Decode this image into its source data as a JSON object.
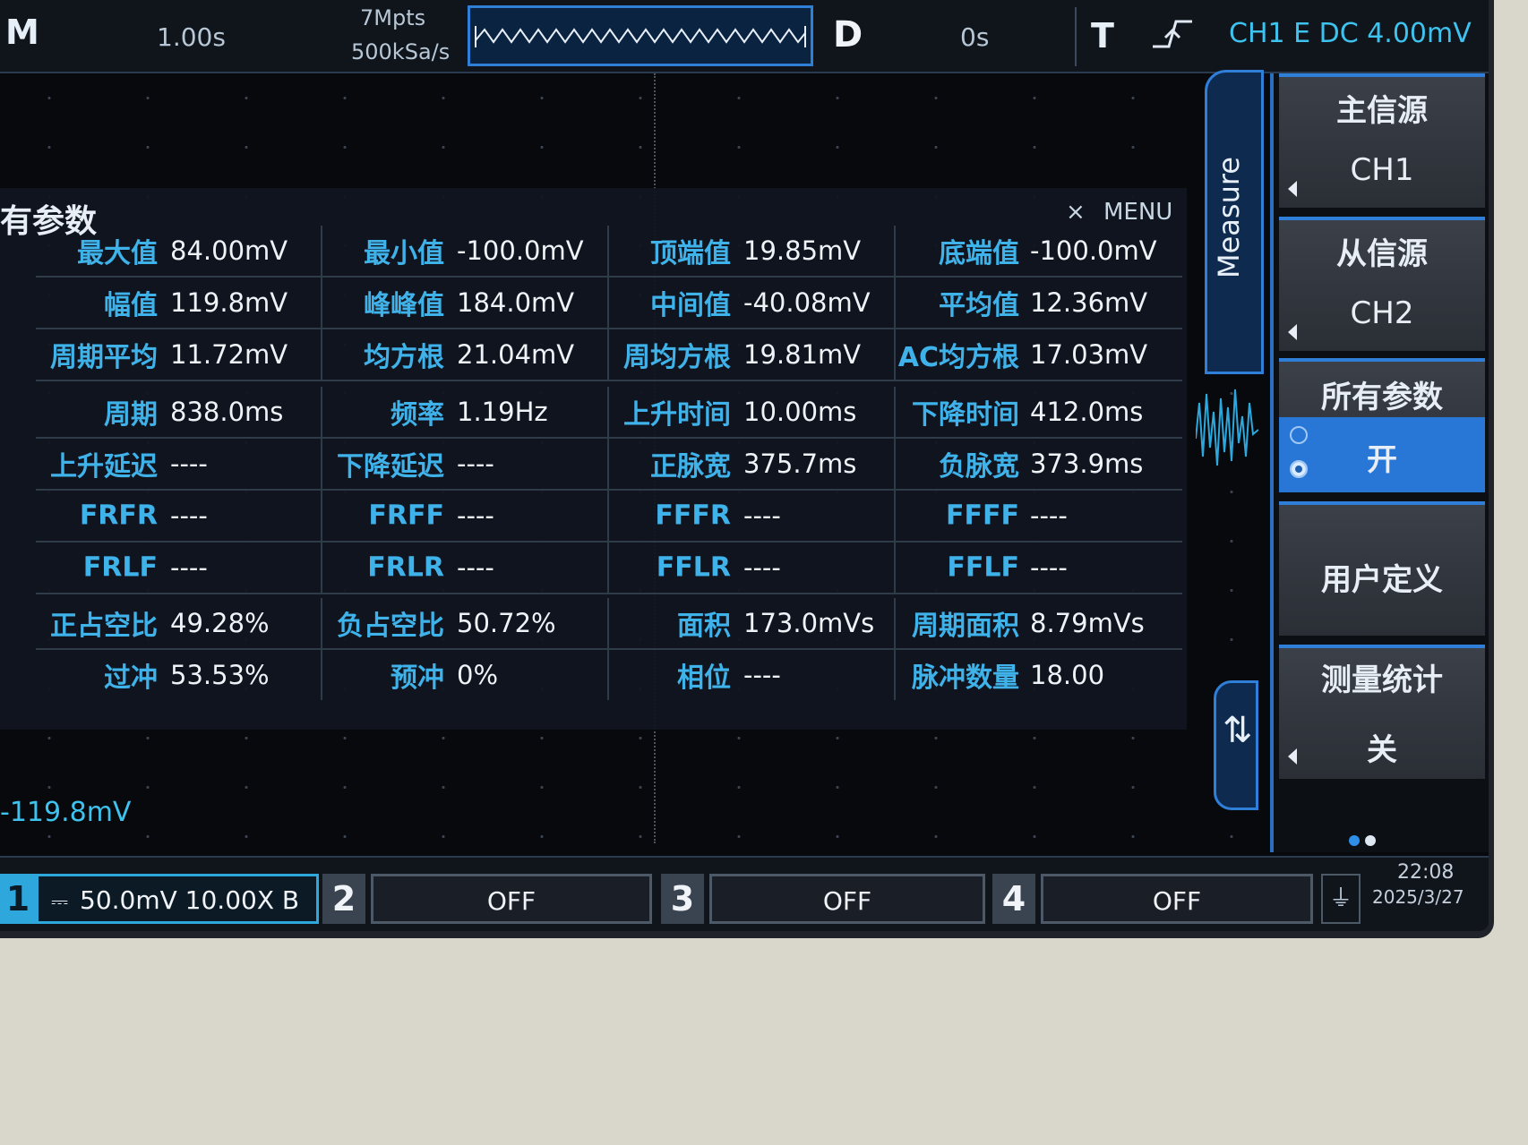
{
  "top_bar": {
    "mode": "M",
    "timebase": "1.00s",
    "memory_depth": "7Mpts",
    "sample_rate": "500kSa/s",
    "delay_label": "D",
    "delay_value": "0s",
    "trigger_label": "T",
    "trigger_info": "CH1 E DC 4.00mV"
  },
  "measure_panel": {
    "title": "有参数",
    "close_icon": "×",
    "menu_label": "MENU",
    "rows": [
      [
        [
          "最大值",
          "84.00mV"
        ],
        [
          "最小值",
          "-100.0mV"
        ],
        [
          "顶端值",
          "19.85mV"
        ],
        [
          "底端值",
          "-100.0mV"
        ]
      ],
      [
        [
          "幅值",
          "119.8mV"
        ],
        [
          "峰峰值",
          "184.0mV"
        ],
        [
          "中间值",
          "-40.08mV"
        ],
        [
          "平均值",
          "12.36mV"
        ]
      ],
      [
        [
          "周期平均",
          "11.72mV"
        ],
        [
          "均方根",
          "21.04mV"
        ],
        [
          "周均方根",
          "19.81mV"
        ],
        [
          "AC均方根",
          "17.03mV"
        ]
      ],
      [
        [
          "周期",
          "838.0ms"
        ],
        [
          "频率",
          "1.19Hz"
        ],
        [
          "上升时间",
          "10.00ms"
        ],
        [
          "下降时间",
          "412.0ms"
        ]
      ],
      [
        [
          "上升延迟",
          "----"
        ],
        [
          "下降延迟",
          "----"
        ],
        [
          "正脉宽",
          "375.7ms"
        ],
        [
          "负脉宽",
          "373.9ms"
        ]
      ],
      [
        [
          "FRFR",
          "----"
        ],
        [
          "FRFF",
          "----"
        ],
        [
          "FFFR",
          "----"
        ],
        [
          "FFFF",
          "----"
        ]
      ],
      [
        [
          "FRLF",
          "----"
        ],
        [
          "FRLR",
          "----"
        ],
        [
          "FFLR",
          "----"
        ],
        [
          "FFLF",
          "----"
        ]
      ],
      [
        [
          "正占空比",
          "49.28%"
        ],
        [
          "负占空比",
          "50.72%"
        ],
        [
          "面积",
          "173.0mVs"
        ],
        [
          "周期面积",
          "8.79mVs"
        ]
      ],
      [
        [
          "过冲",
          "53.53%"
        ],
        [
          "预冲",
          "0%"
        ],
        [
          "相位",
          "----"
        ],
        [
          "脉冲数量",
          "18.00"
        ]
      ]
    ]
  },
  "level_readout": "-119.8mV",
  "side_menu": {
    "tab_label": "Measure",
    "main_source_title": "主信源",
    "main_source_value": "CH1",
    "sub_source_title": "从信源",
    "sub_source_value": "CH2",
    "all_params_title": "所有参数",
    "all_params_value": "开",
    "user_defined": "用户定义",
    "stats_title": "测量统计",
    "stats_value": "关",
    "scroll_icon": "up-down-arrows-icon"
  },
  "bottom_bar": {
    "ch1": {
      "number": "1",
      "coupling_icon": "⎓",
      "scale": "50.0mV 10.00X B"
    },
    "ch2": {
      "number": "2",
      "state": "OFF"
    },
    "ch3": {
      "number": "3",
      "state": "OFF"
    },
    "ch4": {
      "number": "4",
      "state": "OFF"
    },
    "time": "22:08",
    "date": "2025/3/27"
  },
  "colors": {
    "accent": "#2f7fd8",
    "label": "#3fb2ea",
    "ch1": "#2ea8dc",
    "bezel": "#d9d6cc"
  }
}
